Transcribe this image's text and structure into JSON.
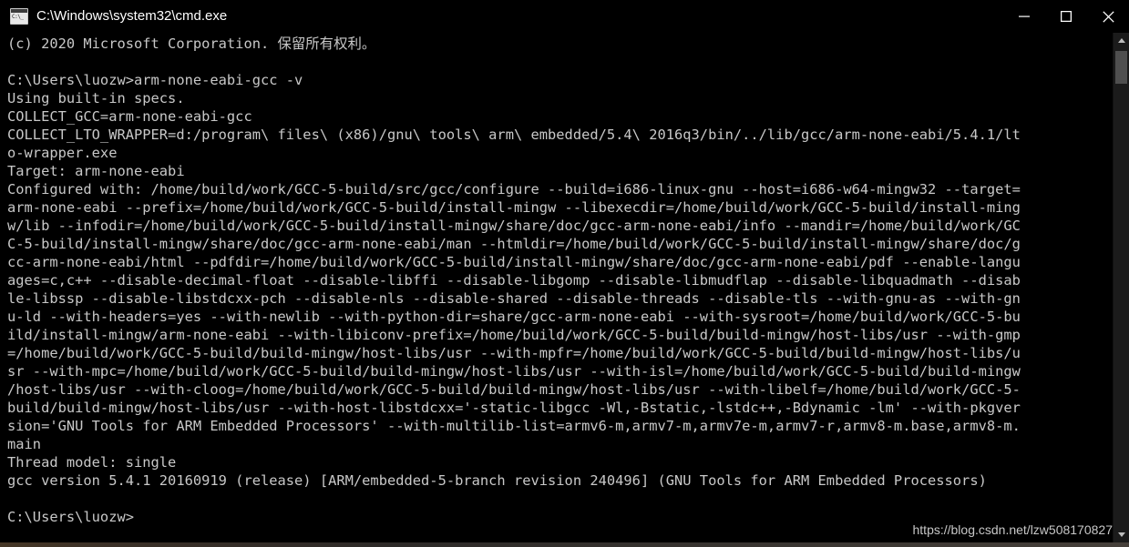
{
  "window": {
    "title": "C:\\Windows\\system32\\cmd.exe",
    "icon": "cmd-console-icon",
    "controls": [
      {
        "name": "minimize-button",
        "glyph": "minimize"
      },
      {
        "name": "maximize-button",
        "glyph": "maximize"
      },
      {
        "name": "close-button",
        "glyph": "close"
      }
    ]
  },
  "console": {
    "background_color": "#000000",
    "text_color": "#c8c8c8",
    "lines": [
      "(c) 2020 Microsoft Corporation. 保留所有权利。",
      "",
      "C:\\Users\\luozw>arm-none-eabi-gcc -v",
      "Using built-in specs.",
      "COLLECT_GCC=arm-none-eabi-gcc",
      "COLLECT_LTO_WRAPPER=d:/program\\ files\\ (x86)/gnu\\ tools\\ arm\\ embedded/5.4\\ 2016q3/bin/../lib/gcc/arm-none-eabi/5.4.1/lt",
      "o-wrapper.exe",
      "Target: arm-none-eabi",
      "Configured with: /home/build/work/GCC-5-build/src/gcc/configure --build=i686-linux-gnu --host=i686-w64-mingw32 --target=",
      "arm-none-eabi --prefix=/home/build/work/GCC-5-build/install-mingw --libexecdir=/home/build/work/GCC-5-build/install-ming",
      "w/lib --infodir=/home/build/work/GCC-5-build/install-mingw/share/doc/gcc-arm-none-eabi/info --mandir=/home/build/work/GC",
      "C-5-build/install-mingw/share/doc/gcc-arm-none-eabi/man --htmldir=/home/build/work/GCC-5-build/install-mingw/share/doc/g",
      "cc-arm-none-eabi/html --pdfdir=/home/build/work/GCC-5-build/install-mingw/share/doc/gcc-arm-none-eabi/pdf --enable-langu",
      "ages=c,c++ --disable-decimal-float --disable-libffi --disable-libgomp --disable-libmudflap --disable-libquadmath --disab",
      "le-libssp --disable-libstdcxx-pch --disable-nls --disable-shared --disable-threads --disable-tls --with-gnu-as --with-gn",
      "u-ld --with-headers=yes --with-newlib --with-python-dir=share/gcc-arm-none-eabi --with-sysroot=/home/build/work/GCC-5-bu",
      "ild/install-mingw/arm-none-eabi --with-libiconv-prefix=/home/build/work/GCC-5-build/build-mingw/host-libs/usr --with-gmp",
      "=/home/build/work/GCC-5-build/build-mingw/host-libs/usr --with-mpfr=/home/build/work/GCC-5-build/build-mingw/host-libs/u",
      "sr --with-mpc=/home/build/work/GCC-5-build/build-mingw/host-libs/usr --with-isl=/home/build/work/GCC-5-build/build-mingw",
      "/host-libs/usr --with-cloog=/home/build/work/GCC-5-build/build-mingw/host-libs/usr --with-libelf=/home/build/work/GCC-5-",
      "build/build-mingw/host-libs/usr --with-host-libstdcxx='-static-libgcc -Wl,-Bstatic,-lstdc++,-Bdynamic -lm' --with-pkgver",
      "sion='GNU Tools for ARM Embedded Processors' --with-multilib-list=armv6-m,armv7-m,armv7e-m,armv7-r,armv8-m.base,armv8-m.",
      "main",
      "Thread model: single",
      "gcc version 5.4.1 20160919 (release) [ARM/embedded-5-branch revision 240496] (GNU Tools for ARM Embedded Processors)",
      "",
      "C:\\Users\\luozw>"
    ]
  },
  "scrollbar": {
    "up_arrow": "scroll-up-arrow",
    "down_arrow": "scroll-down-arrow",
    "thumb": "scroll-thumb"
  },
  "watermark": {
    "text": "https://blog.csdn.net/lzw508170827"
  }
}
